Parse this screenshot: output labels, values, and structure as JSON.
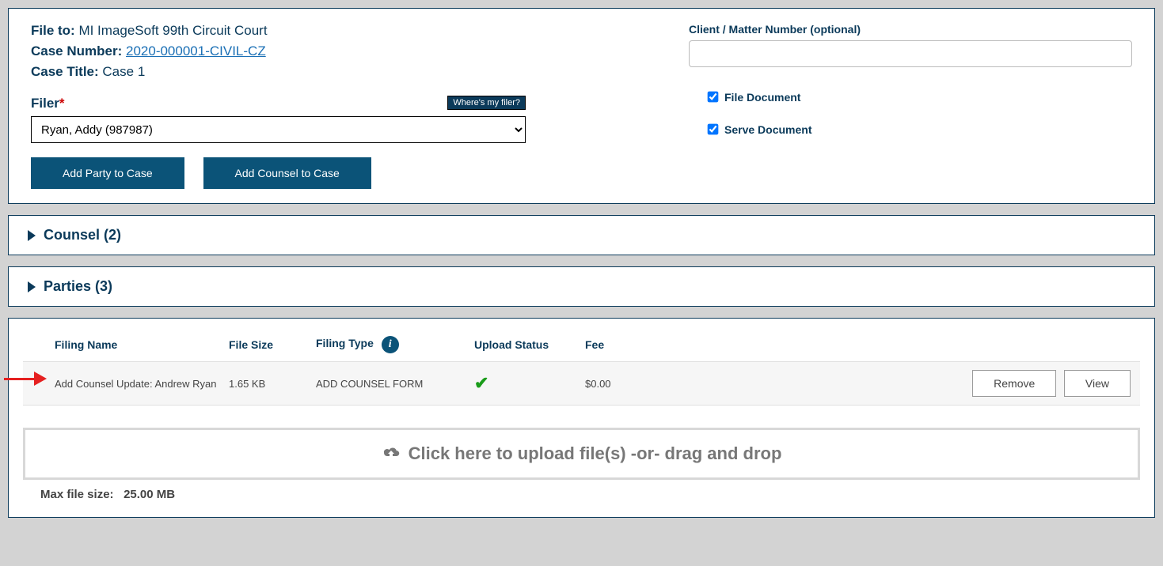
{
  "fileInfo": {
    "fileToLabel": "File to:",
    "fileToValue": "MI ImageSoft 99th Circuit Court",
    "caseNumberLabel": "Case Number:",
    "caseNumberValue": "2020-000001-CIVIL-CZ",
    "caseTitleLabel": "Case Title:",
    "caseTitleValue": "Case 1"
  },
  "filer": {
    "label": "Filer",
    "selected": "Ryan, Addy (987987)",
    "wheresMyFiler": "Where's my filer?"
  },
  "buttons": {
    "addParty": "Add Party to Case",
    "addCounsel": "Add Counsel to Case"
  },
  "clientMatter": {
    "label": "Client / Matter Number (optional)",
    "value": ""
  },
  "checkboxes": {
    "fileDocument": "File Document",
    "serveDocument": "Serve Document",
    "fileDocumentChecked": true,
    "serveDocumentChecked": true
  },
  "accordions": {
    "counsel": "Counsel (2)",
    "parties": "Parties (3)"
  },
  "filings": {
    "headers": {
      "filingName": "Filing Name",
      "fileSize": "File Size",
      "filingType": "Filing Type",
      "uploadStatus": "Upload Status",
      "fee": "Fee"
    },
    "rows": [
      {
        "filingName": "Add Counsel Update: Andrew Ryan",
        "fileSize": "1.65 KB",
        "filingType": "ADD COUNSEL FORM",
        "fee": "$0.00"
      }
    ],
    "actions": {
      "remove": "Remove",
      "view": "View"
    },
    "dropzone": "Click here to upload file(s) -or- drag and drop",
    "maxSizeLabel": "Max file size:",
    "maxSizeValue": "25.00 MB"
  }
}
